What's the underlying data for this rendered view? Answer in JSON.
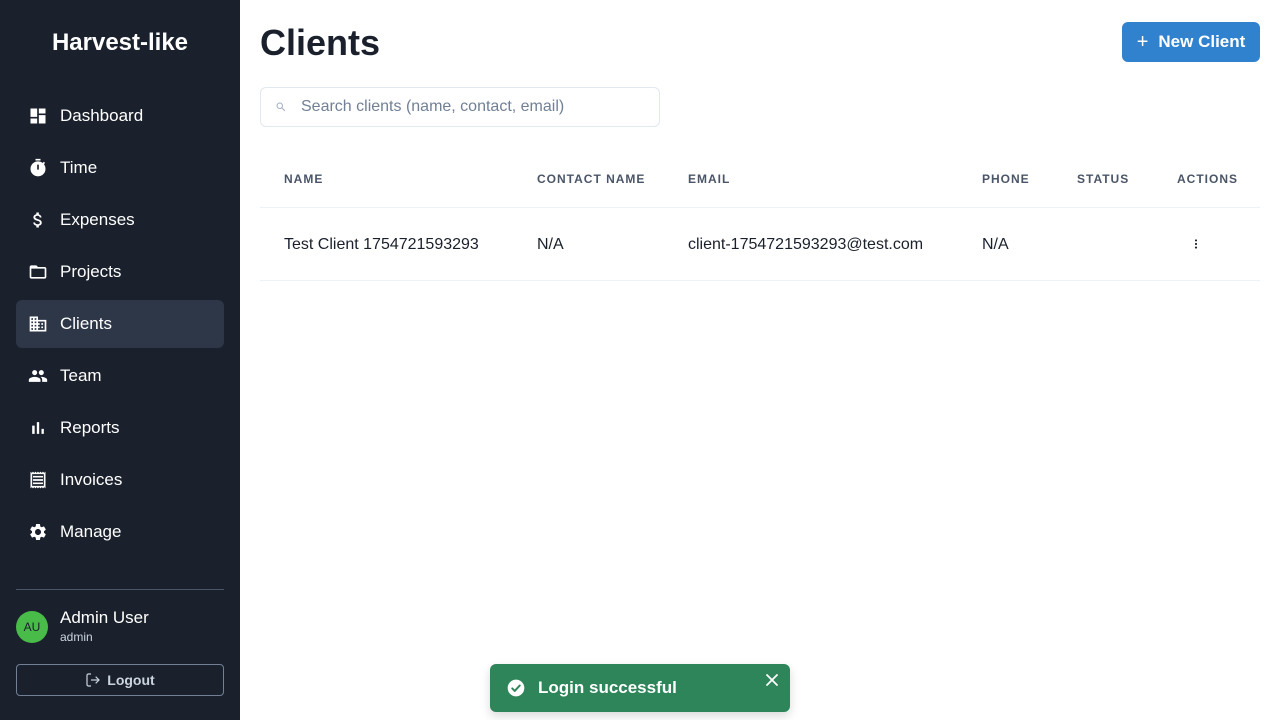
{
  "app": {
    "title": "Harvest-like"
  },
  "sidebar": {
    "items": [
      {
        "label": "Dashboard",
        "icon": "dashboard-icon"
      },
      {
        "label": "Time",
        "icon": "stopwatch-icon"
      },
      {
        "label": "Expenses",
        "icon": "dollar-icon"
      },
      {
        "label": "Projects",
        "icon": "folder-icon"
      },
      {
        "label": "Clients",
        "icon": "building-icon",
        "active": true
      },
      {
        "label": "Team",
        "icon": "team-icon"
      },
      {
        "label": "Reports",
        "icon": "bar-chart-icon"
      },
      {
        "label": "Invoices",
        "icon": "receipt-icon"
      },
      {
        "label": "Manage",
        "icon": "gear-icon"
      }
    ],
    "user": {
      "initials": "AU",
      "name": "Admin User",
      "role": "admin"
    },
    "logout_label": "Logout"
  },
  "page": {
    "title": "Clients",
    "new_button_label": "New Client",
    "search_placeholder": "Search clients (name, contact, email)"
  },
  "table": {
    "headers": [
      "NAME",
      "CONTACT NAME",
      "EMAIL",
      "PHONE",
      "STATUS",
      "ACTIONS"
    ],
    "rows": [
      {
        "name": "Test Client 1754721593293",
        "contact": "N/A",
        "email": "client-1754721593293@test.com",
        "phone": "N/A",
        "status": ""
      }
    ]
  },
  "toast": {
    "message": "Login successful",
    "type": "success"
  },
  "colors": {
    "sidebar_bg": "#1a202c",
    "accent": "#3182ce",
    "toast_success": "#2f855a",
    "avatar": "#48bb48"
  }
}
